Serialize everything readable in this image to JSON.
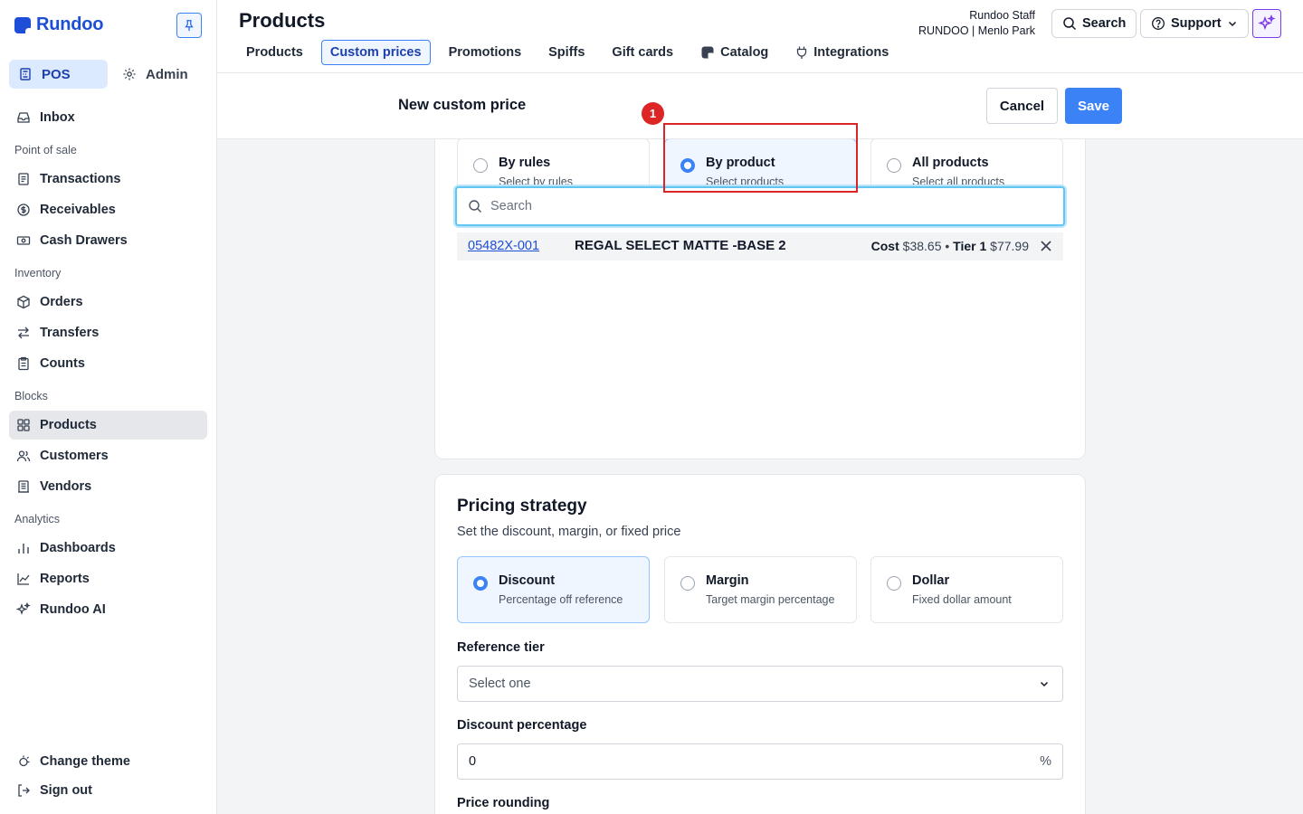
{
  "app": {
    "brand": "Rundoo",
    "modes": [
      {
        "label": "POS",
        "icon": "register-icon"
      },
      {
        "label": "Admin",
        "icon": "gear-icon"
      }
    ]
  },
  "sidebar": {
    "inbox": "Inbox",
    "sections": {
      "point_of_sale": "Point of sale",
      "inventory": "Inventory",
      "blocks": "Blocks",
      "analytics": "Analytics"
    },
    "items": {
      "transactions": "Transactions",
      "receivables": "Receivables",
      "cash_drawers": "Cash Drawers",
      "orders": "Orders",
      "transfers": "Transfers",
      "counts": "Counts",
      "products": "Products",
      "customers": "Customers",
      "vendors": "Vendors",
      "dashboards": "Dashboards",
      "reports": "Reports",
      "rundoo_ai": "Rundoo AI"
    },
    "change_theme": "Change theme",
    "sign_out": "Sign out"
  },
  "header": {
    "title": "Products",
    "tabs": [
      "Products",
      "Custom prices",
      "Promotions",
      "Spiffs",
      "Gift cards",
      "Catalog",
      "Integrations"
    ],
    "active_tab": "Custom prices",
    "user_name": "Rundoo Staff",
    "user_store": "RUNDOO | Menlo Park",
    "search_label": "Search",
    "support_label": "Support"
  },
  "subheader": {
    "title": "New custom price",
    "cancel": "Cancel",
    "save": "Save"
  },
  "selection": {
    "options": [
      {
        "title": "By rules",
        "subtitle": "Select by rules",
        "selected": false
      },
      {
        "title": "By product",
        "subtitle": "Select products",
        "selected": true
      },
      {
        "title": "All products",
        "subtitle": "Select all products",
        "selected": false
      }
    ],
    "search_placeholder": "Search",
    "result": {
      "sku": "05482X-001",
      "name": "REGAL SELECT MATTE -BASE 2",
      "cost_label": "Cost",
      "cost": "$38.65",
      "separator": "•",
      "tier_label": "Tier 1",
      "tier_price": "$77.99"
    }
  },
  "pricing": {
    "title": "Pricing strategy",
    "subtitle": "Set the discount, margin, or fixed price",
    "options": [
      {
        "title": "Discount",
        "subtitle": "Percentage off reference",
        "selected": true
      },
      {
        "title": "Margin",
        "subtitle": "Target margin percentage",
        "selected": false
      },
      {
        "title": "Dollar",
        "subtitle": "Fixed dollar amount",
        "selected": false
      }
    ],
    "reference_tier_label": "Reference tier",
    "reference_tier_value": "Select one",
    "discount_label": "Discount percentage",
    "discount_value": "0",
    "discount_unit": "%",
    "rounding_label": "Price rounding"
  },
  "annotation": {
    "badge": "1",
    "color": "#dc2626"
  },
  "colors": {
    "accent": "#3b82f6",
    "brand": "#1d4ed8",
    "ai": "#7c3aed"
  }
}
